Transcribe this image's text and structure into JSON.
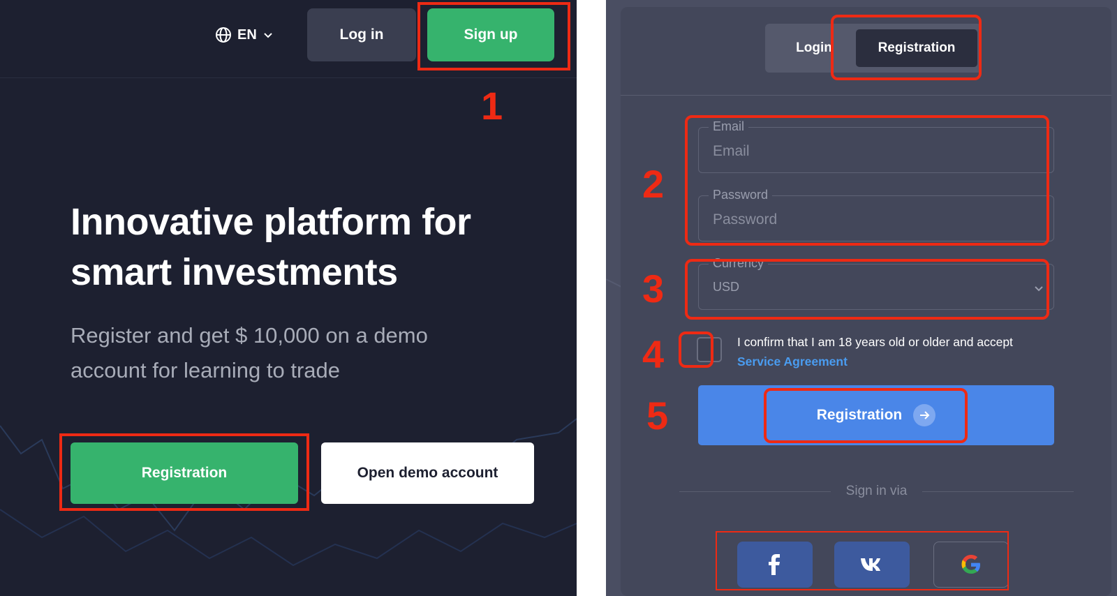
{
  "header": {
    "language": "EN",
    "login_label": "Log in",
    "signup_label": "Sign up"
  },
  "hero": {
    "title": "Innovative platform for smart investments",
    "subtitle": "Register and get $ 10,000 on a demo account for learning to trade",
    "registration_label": "Registration",
    "demo_label": "Open demo account"
  },
  "auth_form": {
    "tabs": [
      {
        "label": "Login",
        "active": false
      },
      {
        "label": "Registration",
        "active": true
      }
    ],
    "email": {
      "label": "Email",
      "placeholder": "Email"
    },
    "password": {
      "label": "Password",
      "placeholder": "Password"
    },
    "currency": {
      "label": "Currency",
      "value": "USD"
    },
    "confirm_text": "I confirm that I am 18 years old or older and accept",
    "agreement_link": "Service Agreement",
    "submit_label": "Registration",
    "signin_via": "Sign in via",
    "social": [
      {
        "icon": "facebook-icon",
        "glyph": "f"
      },
      {
        "icon": "vk-icon",
        "glyph": "vk"
      },
      {
        "icon": "google-icon",
        "glyph": "G"
      }
    ]
  },
  "annotations": {
    "steps": [
      "1",
      "2",
      "3",
      "4",
      "5"
    ],
    "color": "#ee2a14"
  },
  "colors": {
    "left_bg": "#1d2030",
    "green": "#36b36d",
    "blue": "#4a86e8",
    "card_bg": "#43475a"
  }
}
